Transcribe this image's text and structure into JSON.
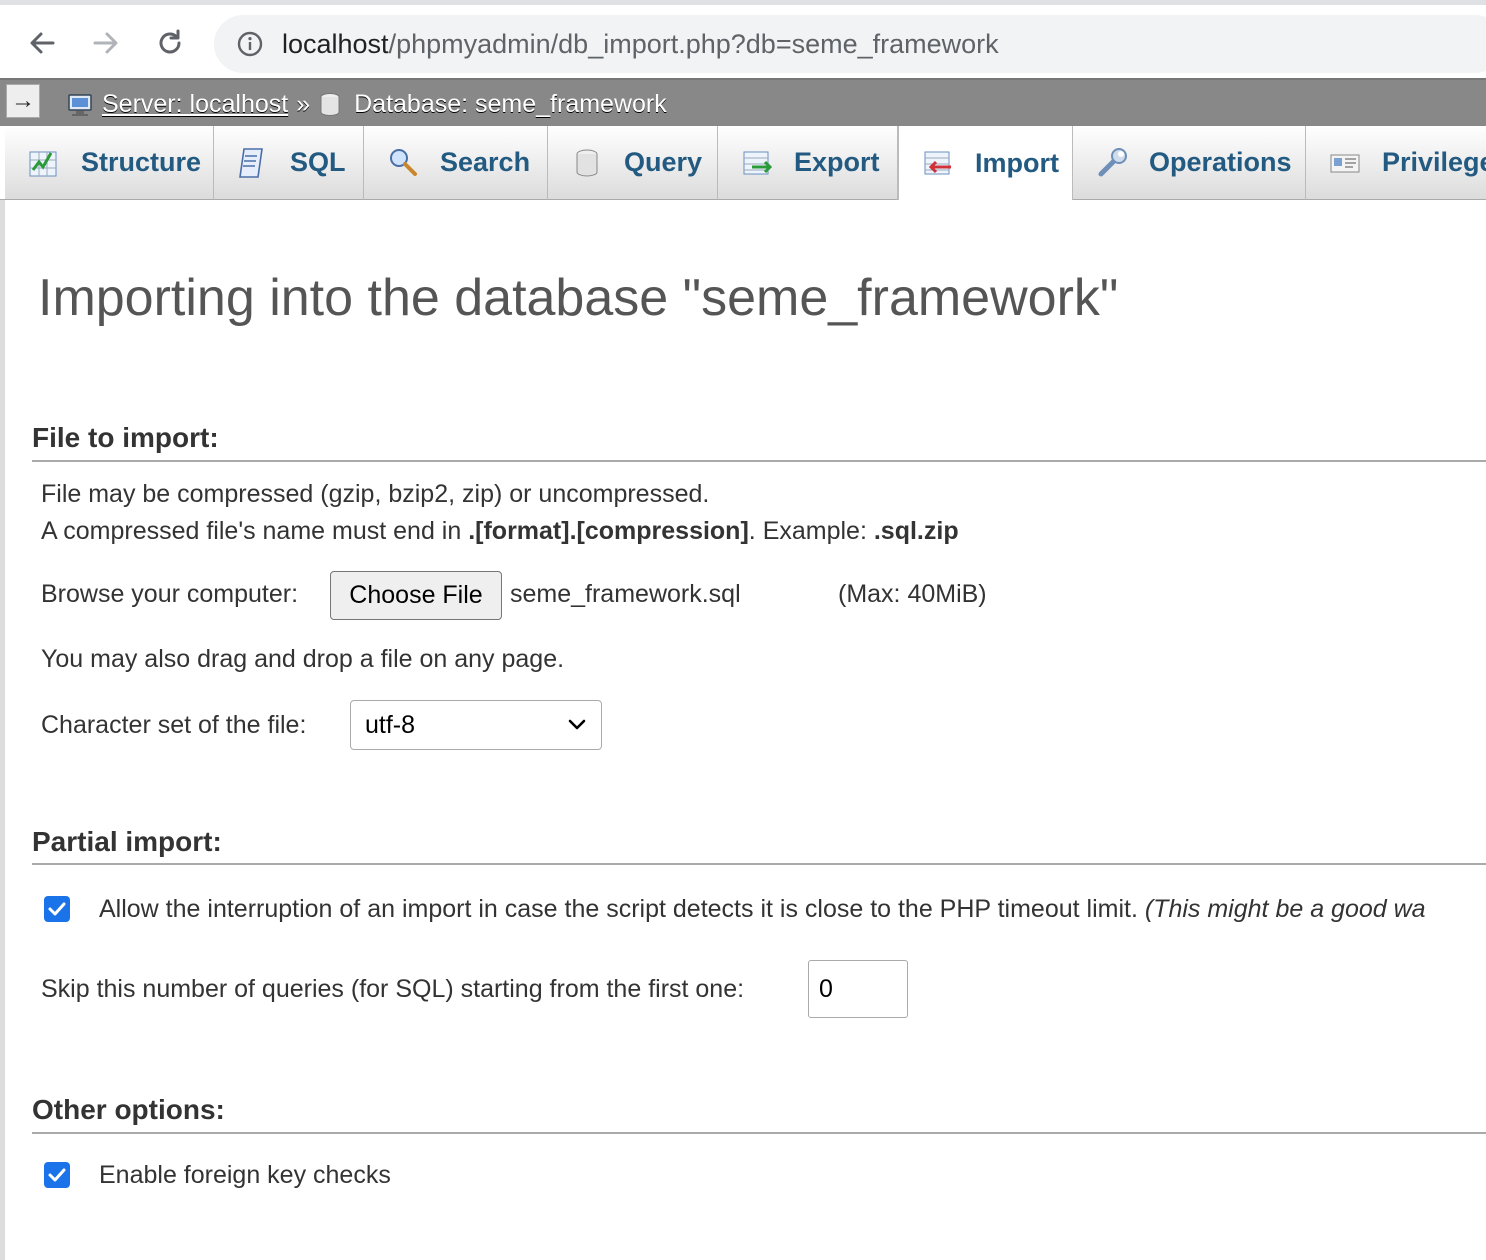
{
  "browser": {
    "url_host": "localhost",
    "url_path": "/phpmyadmin/db_import.php?db=seme_framework"
  },
  "breadcrumb": {
    "server": "Server: localhost",
    "separator": "»",
    "database": "Database: seme_framework"
  },
  "tabs": [
    {
      "label": "Structure",
      "icon": "structure-icon",
      "active": false
    },
    {
      "label": "SQL",
      "icon": "sql-icon",
      "active": false
    },
    {
      "label": "Search",
      "icon": "search-icon",
      "active": false
    },
    {
      "label": "Query",
      "icon": "query-icon",
      "active": false
    },
    {
      "label": "Export",
      "icon": "export-icon",
      "active": false
    },
    {
      "label": "Import",
      "icon": "import-icon",
      "active": true
    },
    {
      "label": "Operations",
      "icon": "wrench-icon",
      "active": false
    },
    {
      "label": "Privileges",
      "icon": "privileges-icon",
      "active": false
    }
  ],
  "page": {
    "title": "Importing into the database \"seme_framework\""
  },
  "file_section": {
    "title": "File to import:",
    "line1": "File may be compressed (gzip, bzip2, zip) or uncompressed.",
    "line2_prefix": "A compressed file's name must end in ",
    "line2_format": ".[format].[compression]",
    "line2_mid": ". Example: ",
    "line2_example": ".sql.zip",
    "browse_label": "Browse your computer:",
    "choose_button": "Choose File",
    "file_name": "seme_framework.sql",
    "max_size": "(Max: 40MiB)",
    "drag_note": "You may also drag and drop a file on any page.",
    "charset_label": "Character set of the file:",
    "charset_value": "utf-8"
  },
  "partial_section": {
    "title": "Partial import:",
    "allow_interrupt_checked": true,
    "allow_interrupt_label": "Allow the interruption of an import in case the script detects it is close to the PHP timeout limit.",
    "allow_interrupt_hint": "(This might be a good wa",
    "skip_label": "Skip this number of queries (for SQL) starting from the first one:",
    "skip_value": "0"
  },
  "other_section": {
    "title": "Other options:",
    "foreign_key_checked": true,
    "foreign_key_label": "Enable foreign key checks"
  },
  "colors": {
    "tab_text": "#235a81",
    "checkbox": "#1a73e8",
    "breadcrumb_bg": "#888888"
  }
}
